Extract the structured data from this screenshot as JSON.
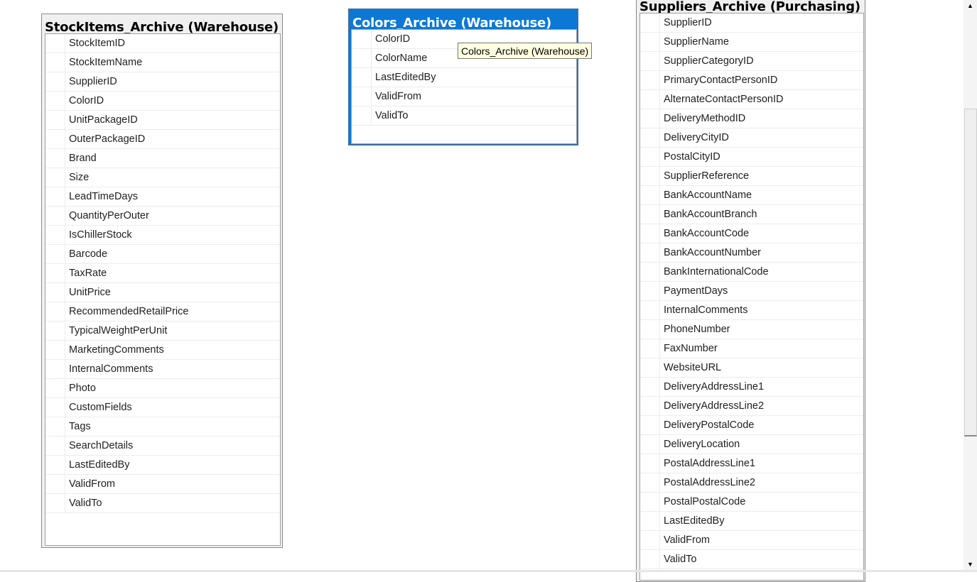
{
  "tables": [
    {
      "title": "StockItems_Archive (Warehouse)",
      "columns": [
        "StockItemID",
        "StockItemName",
        "SupplierID",
        "ColorID",
        "UnitPackageID",
        "OuterPackageID",
        "Brand",
        "Size",
        "LeadTimeDays",
        "QuantityPerOuter",
        "IsChillerStock",
        "Barcode",
        "TaxRate",
        "UnitPrice",
        "RecommendedRetailPrice",
        "TypicalWeightPerUnit",
        "MarketingComments",
        "InternalComments",
        "Photo",
        "CustomFields",
        "Tags",
        "SearchDetails",
        "LastEditedBy",
        "ValidFrom",
        "ValidTo"
      ]
    },
    {
      "title": "Colors_Archive (Warehouse)",
      "selected": true,
      "columns": [
        "ColorID",
        "ColorName",
        "LastEditedBy",
        "ValidFrom",
        "ValidTo"
      ]
    },
    {
      "title": "Suppliers_Archive (Purchasing)",
      "columns": [
        "SupplierID",
        "SupplierName",
        "SupplierCategoryID",
        "PrimaryContactPersonID",
        "AlternateContactPersonID",
        "DeliveryMethodID",
        "DeliveryCityID",
        "PostalCityID",
        "SupplierReference",
        "BankAccountName",
        "BankAccountBranch",
        "BankAccountCode",
        "BankAccountNumber",
        "BankInternationalCode",
        "PaymentDays",
        "InternalComments",
        "PhoneNumber",
        "FaxNumber",
        "WebsiteURL",
        "DeliveryAddressLine1",
        "DeliveryAddressLine2",
        "DeliveryPostalCode",
        "DeliveryLocation",
        "PostalAddressLine1",
        "PostalAddressLine2",
        "PostalPostalCode",
        "LastEditedBy",
        "ValidFrom",
        "ValidTo"
      ]
    }
  ],
  "tooltip": "Colors_Archive (Warehouse)",
  "scrollbar": {
    "up_icon": "▲",
    "down_icon": "▼"
  },
  "colors": {
    "selected_header": "#0a78d4",
    "tooltip_bg": "#ffffe1"
  }
}
